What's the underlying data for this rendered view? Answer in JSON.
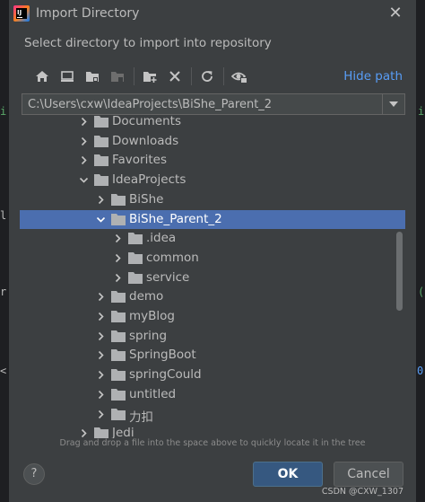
{
  "dialog": {
    "title": "Import Directory",
    "subtitle": "Select directory to import into repository",
    "hide_path_label": "Hide path",
    "path_value": "C:\\Users\\cxw\\IdeaProjects\\BiShe_Parent_2",
    "hint": "Drag and drop a file into the space above to quickly locate it in the tree",
    "ok_label": "OK",
    "cancel_label": "Cancel",
    "help_label": "?"
  },
  "toolbar_icons": [
    "home-icon",
    "desktop-icon",
    "project-folder-icon",
    "module-folder-icon",
    "new-folder-icon",
    "delete-icon",
    "refresh-icon",
    "show-hidden-icon"
  ],
  "tree": {
    "items": [
      {
        "label": "Documents",
        "level": 0,
        "expanded": false,
        "selected": false
      },
      {
        "label": "Downloads",
        "level": 0,
        "expanded": false,
        "selected": false
      },
      {
        "label": "Favorites",
        "level": 0,
        "expanded": false,
        "selected": false
      },
      {
        "label": "IdeaProjects",
        "level": 0,
        "expanded": true,
        "selected": false
      },
      {
        "label": "BiShe",
        "level": 1,
        "expanded": false,
        "selected": false
      },
      {
        "label": "BiShe_Parent_2",
        "level": 1,
        "expanded": true,
        "selected": true
      },
      {
        "label": ".idea",
        "level": 2,
        "expanded": false,
        "selected": false
      },
      {
        "label": "common",
        "level": 2,
        "expanded": false,
        "selected": false
      },
      {
        "label": "service",
        "level": 2,
        "expanded": false,
        "selected": false
      },
      {
        "label": "demo",
        "level": 1,
        "expanded": false,
        "selected": false
      },
      {
        "label": "myBlog",
        "level": 1,
        "expanded": false,
        "selected": false
      },
      {
        "label": "spring",
        "level": 1,
        "expanded": false,
        "selected": false
      },
      {
        "label": "SpringBoot",
        "level": 1,
        "expanded": false,
        "selected": false
      },
      {
        "label": "springCould",
        "level": 1,
        "expanded": false,
        "selected": false
      },
      {
        "label": "untitled",
        "level": 1,
        "expanded": false,
        "selected": false
      },
      {
        "label": "力扣",
        "level": 1,
        "expanded": false,
        "selected": false
      },
      {
        "label": "Jedi",
        "level": 0,
        "expanded": false,
        "selected": false
      }
    ]
  },
  "watermark": "CSDN @CXW_1307",
  "colors": {
    "dialog_bg": "#3c3f41",
    "selection": "#4b6eaf",
    "link": "#589df6",
    "ok_button": "#365880",
    "folder": "#afb1b3"
  }
}
